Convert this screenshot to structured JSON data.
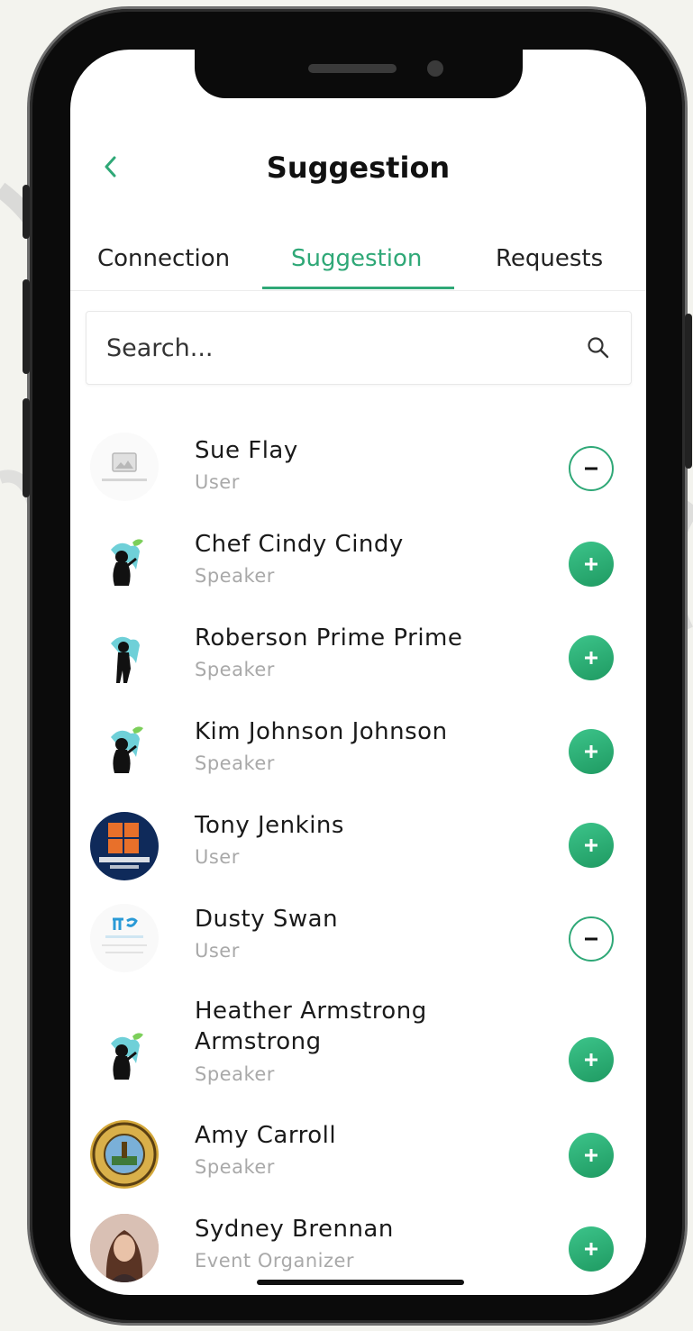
{
  "header": {
    "title": "Suggestion"
  },
  "tabs": [
    {
      "label": "Connection",
      "active": false
    },
    {
      "label": "Suggestion",
      "active": true
    },
    {
      "label": "Requests",
      "active": false
    }
  ],
  "search": {
    "placeholder": "Search..."
  },
  "accent_color": "#2fa877",
  "users": [
    {
      "name": "Sue Flay",
      "role": "User",
      "avatar": "image-placeholder-icon",
      "action": "remove"
    },
    {
      "name": "Chef Cindy Cindy",
      "role": "Speaker",
      "avatar": "speaker-silhouette-icon",
      "action": "add"
    },
    {
      "name": "Roberson Prime Prime",
      "role": "Speaker",
      "avatar": "speaker-silhouette-icon",
      "action": "add"
    },
    {
      "name": "Kim Johnson Johnson",
      "role": "Speaker",
      "avatar": "speaker-silhouette-icon",
      "action": "add"
    },
    {
      "name": "Tony Jenkins",
      "role": "User",
      "avatar": "ocps-logo",
      "action": "add"
    },
    {
      "name": "Dusty Swan",
      "role": "User",
      "avatar": "fig-logo",
      "action": "remove"
    },
    {
      "name": "Heather Armstrong Armstrong",
      "role": "Speaker",
      "avatar": "speaker-silhouette-icon",
      "action": "add"
    },
    {
      "name": "Amy Carroll",
      "role": "Speaker",
      "avatar": "county-seal-logo",
      "action": "add"
    },
    {
      "name": "Sydney Brennan",
      "role": "Event Organizer",
      "avatar": "profile-photo",
      "action": "add"
    }
  ]
}
